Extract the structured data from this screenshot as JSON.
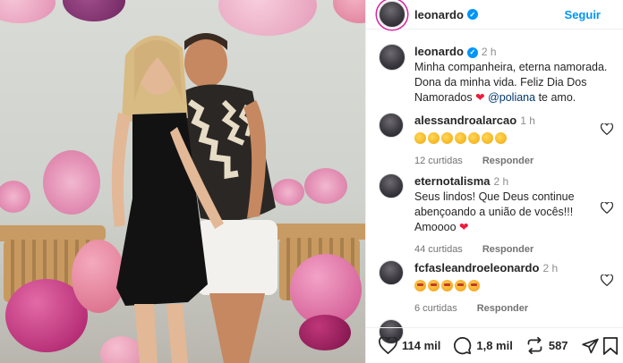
{
  "post_header": {
    "username": "leonardo",
    "follow_label": "Seguir"
  },
  "caption": {
    "username": "leonardo",
    "time": "2 h",
    "text_line_1": "Minha companheira, eterna namorada.",
    "text_line_2": "Dona da minha vida. Feliz Dia Dos",
    "text_line_3_pre": "Namorados",
    "mention": "@poliana",
    "text_line_3_post": "te amo."
  },
  "comments": [
    {
      "username": "alessandroalarcao",
      "time": "1 h",
      "emoji_count": 7,
      "likes": "12 curtidas",
      "reply_label": "Responder"
    },
    {
      "username": "eternotalisma",
      "time": "2 h",
      "text_line_1": "Seus lindos! Que Deus continue",
      "text_line_2": "abençoando a união de vocês!!!",
      "text_line_3": "Amoooo",
      "likes": "44 curtidas",
      "reply_label": "Responder"
    },
    {
      "username": "fcfasleandroeleonardo",
      "time": "2 h",
      "emoji_count": 5,
      "likes": "6 curtidas",
      "reply_label": "Responder"
    }
  ],
  "actions": {
    "likes": "114 mil",
    "comments": "1,8 mil",
    "reposts": "587"
  },
  "colors": {
    "accent": "#0095f6",
    "heart": "#ed1b3d",
    "mention": "#00376b"
  },
  "icons": [
    "verified-icon",
    "heart-icon",
    "comment-icon",
    "repost-icon",
    "share-icon",
    "bookmark-icon"
  ]
}
